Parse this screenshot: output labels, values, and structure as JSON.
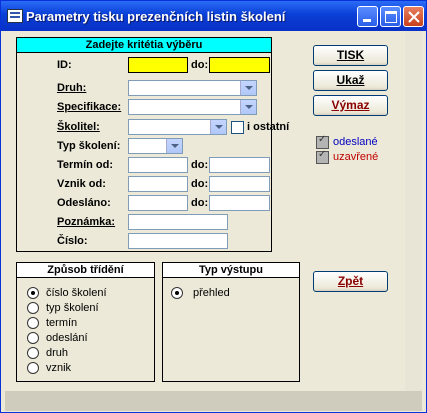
{
  "window": {
    "title": "Parametry tisku prezenčních listin školení"
  },
  "criteria": {
    "header": "Zadejte kritétia výběru",
    "id_label": "ID:",
    "do_label": "do:",
    "druh_label": "Druh:",
    "specifikace_label": "Specifikace:",
    "skolitel_label": "Školitel:",
    "ostatni_label": "i ostatní",
    "typ_skoleni_label": "Typ školení:",
    "termin_od_label": "Termín od:",
    "vznik_od_label": "Vznik od:",
    "odeslano_label": "Odesláno:",
    "poznamka_label": "Poznámka:",
    "cislo_label": "Číslo:"
  },
  "buttons": {
    "tisk": "TISK",
    "ukaz": "Ukaž",
    "vymaz": "Výmaz",
    "zpet": "Zpět"
  },
  "status": {
    "odeslane": "odeslané",
    "uzavrene": "uzavřené"
  },
  "sort": {
    "title": "Způsob třídění",
    "options": [
      "číslo školení",
      "typ školení",
      "termín",
      "odeslání",
      "druh",
      "vznik"
    ],
    "selected": "číslo školení"
  },
  "output": {
    "title": "Typ výstupu",
    "options": [
      "přehled"
    ],
    "selected": "přehled"
  },
  "colors": {
    "status_text": "#0000c0",
    "uzavrene_text": "#c00000",
    "header_bg": "#00ffff",
    "id_field_bg": "#ffff00"
  }
}
